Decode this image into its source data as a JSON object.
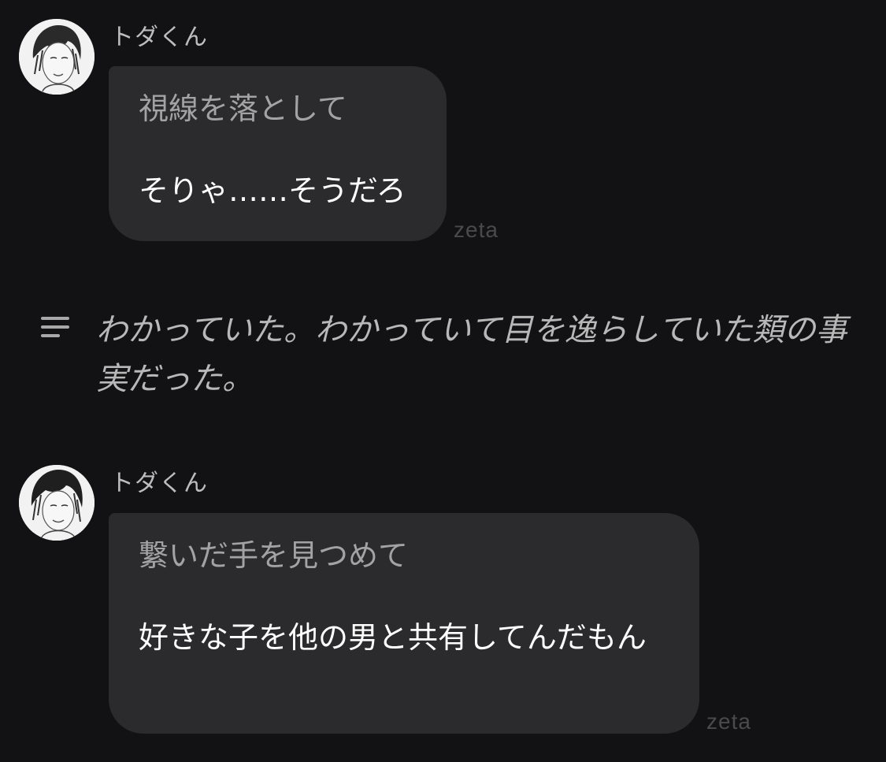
{
  "chat": {
    "messages": [
      {
        "sender": "トダくん",
        "action": "視線を落として",
        "speech": "そりゃ……そうだろ",
        "watermark": "zeta"
      },
      {
        "sender": "トダくん",
        "action": "繋いだ手を見つめて",
        "speech": "好きな子を他の男と共有してんだもん",
        "watermark": "zeta"
      }
    ],
    "narration": {
      "icon": "menu-lines-icon",
      "text": "わかっていた。わかっていて目を逸らしていた類の事実だった。"
    }
  },
  "colors": {
    "background": "#121214",
    "bubble": "#2b2b2e",
    "speech_text": "#ffffff",
    "action_text": "#a3a3a3"
  }
}
